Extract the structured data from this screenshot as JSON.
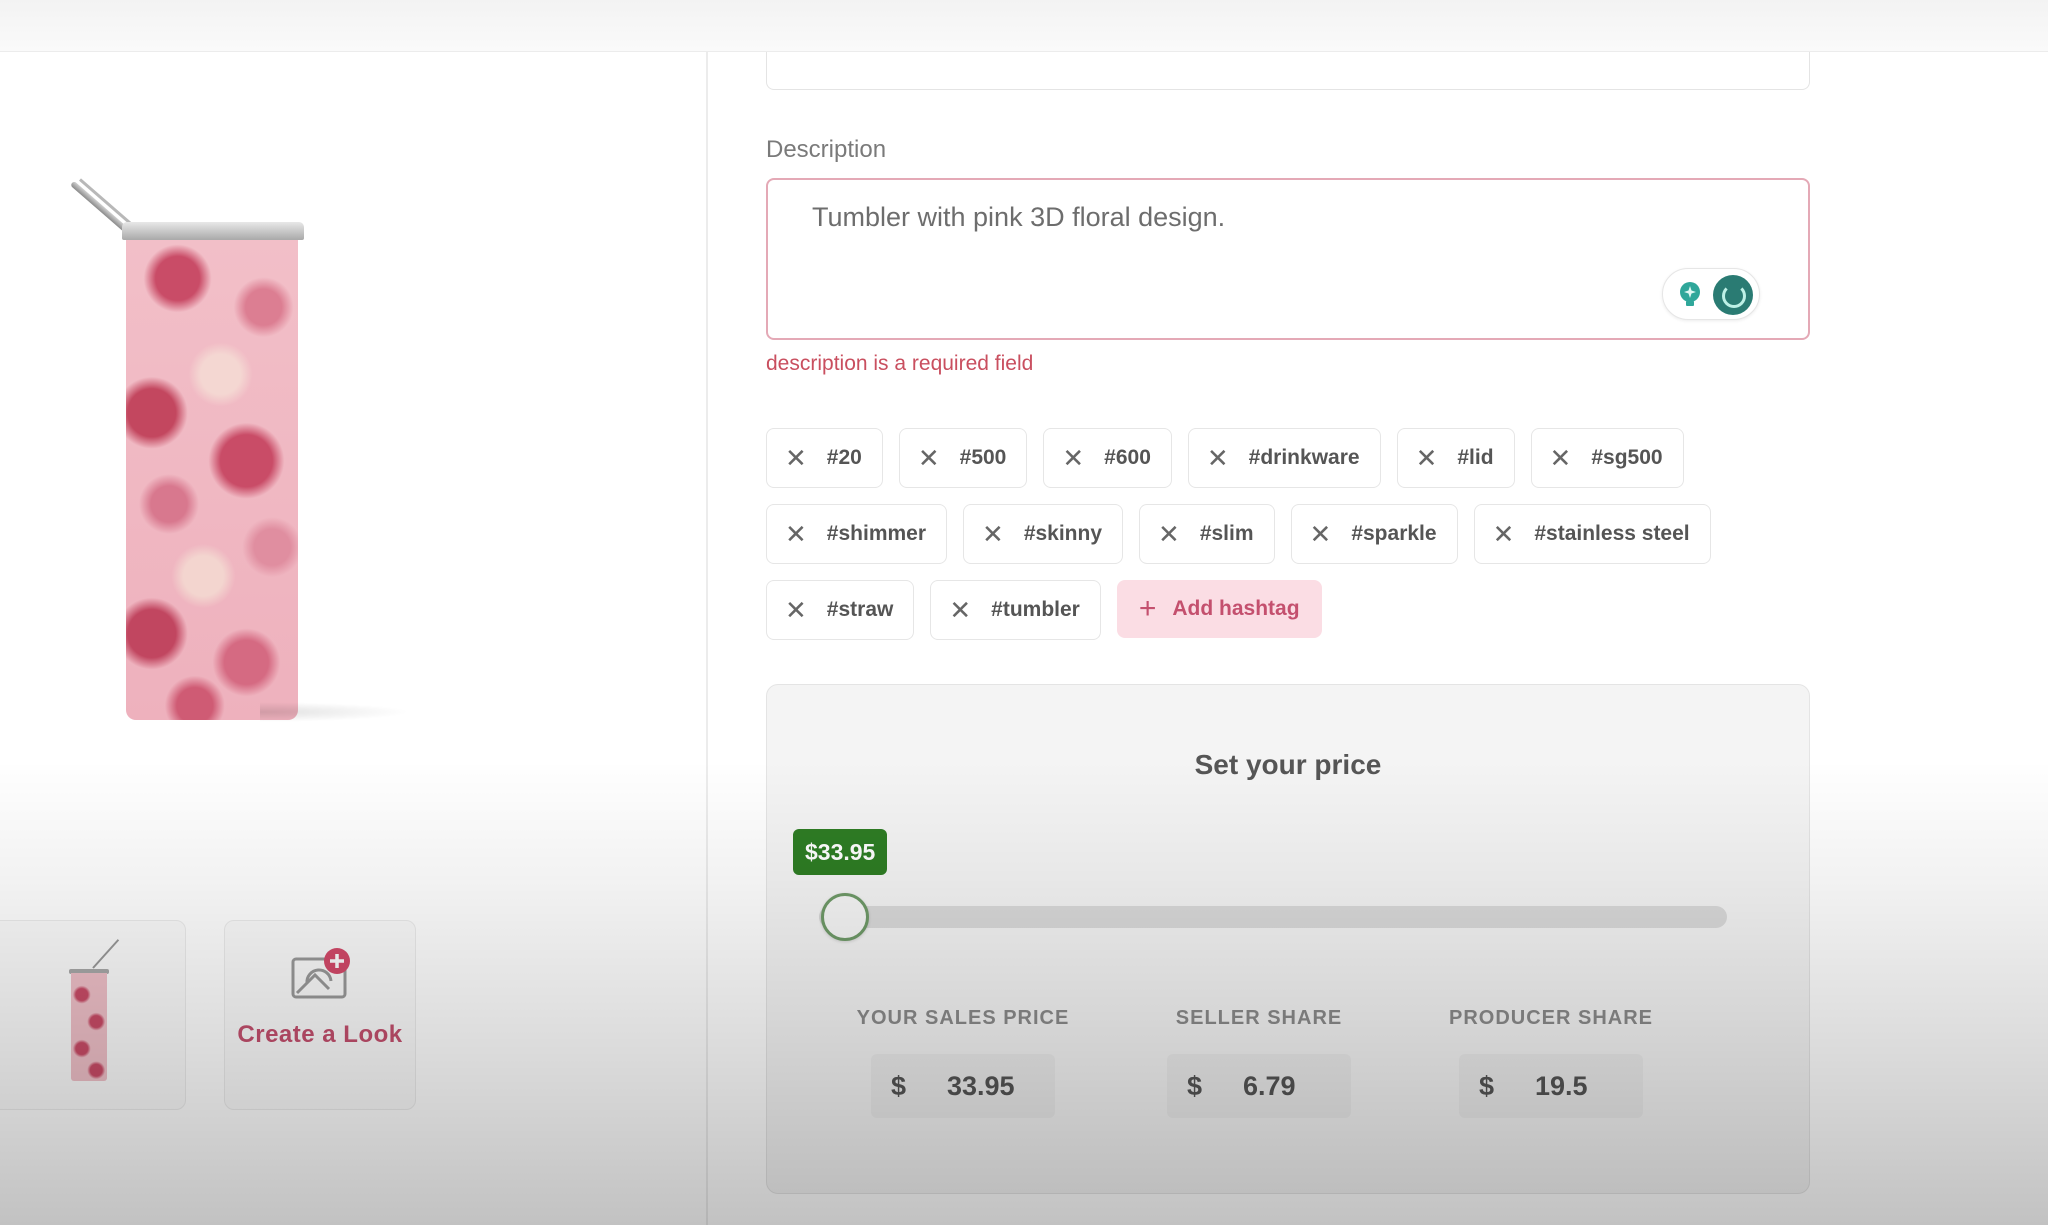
{
  "product": {
    "image_alt": "Pink 3D floral skinny tumbler with straw",
    "thumbnail_alt": "Tumbler thumbnail",
    "create_look_label": "Create a Look"
  },
  "description": {
    "label": "Description",
    "value": "Tumbler with pink 3D floral design.",
    "error": "description is a required field",
    "ai_tools": [
      "lightbulb-sparkle-icon",
      "loading-spinner-icon"
    ]
  },
  "hashtags": {
    "rows": [
      [
        "#20",
        "#500",
        "#600",
        "#drinkware",
        "#lid",
        "#sg500"
      ],
      [
        "#shimmer",
        "#skinny",
        "#slim",
        "#sparkle",
        "#stainless steel"
      ],
      [
        "#straw",
        "#tumbler"
      ]
    ],
    "remove_icon": "close-x-icon",
    "add_label": "Add hashtag"
  },
  "pricing": {
    "title": "Set your price",
    "slider_value_label": "$33.95",
    "slider_position_fraction": 0.0,
    "columns": [
      {
        "label": "YOUR SALES PRICE",
        "currency": "$",
        "value": "33.95"
      },
      {
        "label": "SELLER SHARE",
        "currency": "$",
        "value": "6.79"
      },
      {
        "label": "PRODUCER SHARE",
        "currency": "$",
        "value": "19.5"
      }
    ]
  },
  "colors": {
    "accent_pink": "#c4506e",
    "error_red": "#c94f5f",
    "price_green": "#2e7d24",
    "ai_teal": "#2a7b73"
  }
}
